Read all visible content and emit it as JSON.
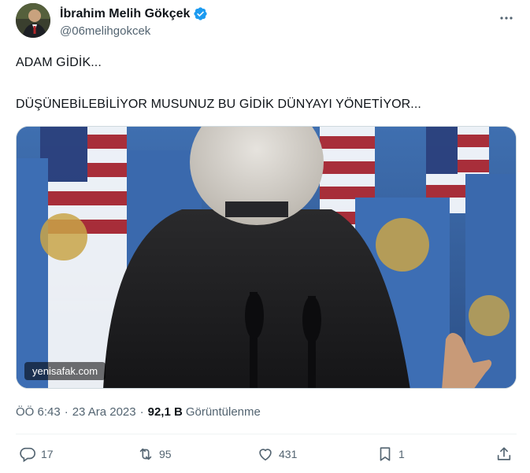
{
  "author": {
    "display_name": "İbrahim Melih Gökçek",
    "handle": "@06melihgokcek",
    "verified_icon": "verified-badge-icon"
  },
  "tweet": {
    "lines": [
      "ADAM GİDİK...",
      "DÜŞÜNEBİLEBİLİYOR MUSUNUZ BU GİDİK DÜNYAYI YÖNETİYOR..."
    ]
  },
  "media": {
    "source_label": "yenisafak.com"
  },
  "meta": {
    "time": "ÖÖ 6:43",
    "date": "23 Ara 2023",
    "views_count": "92,1 B",
    "views_label": "Görüntülenme"
  },
  "actions": {
    "replies": "17",
    "retweets": "95",
    "likes": "431",
    "bookmarks": "1"
  },
  "colors": {
    "text_primary": "#0f1419",
    "text_secondary": "#536471",
    "verified": "#1d9bf0",
    "divider": "#eff3f4"
  }
}
